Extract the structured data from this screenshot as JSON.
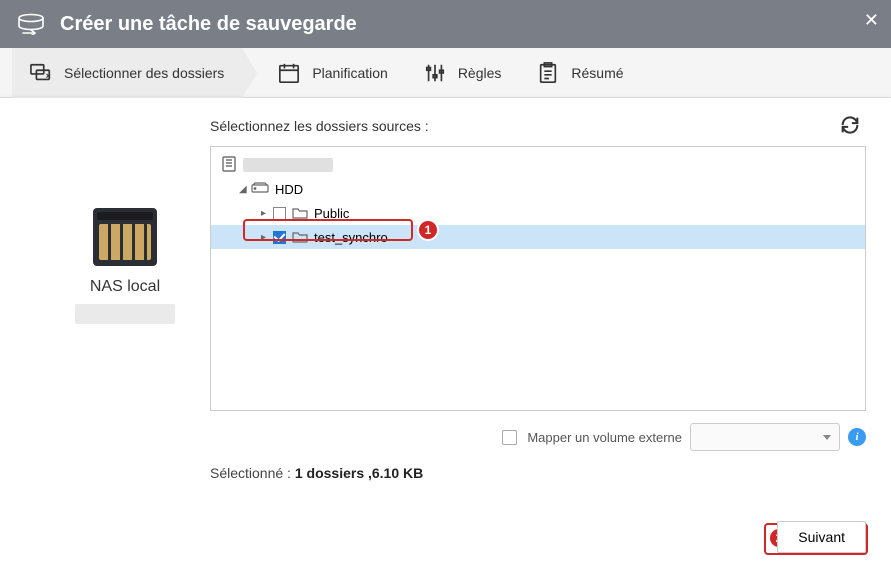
{
  "header": {
    "title": "Créer une tâche de sauvegarde"
  },
  "steps": {
    "select": "Sélectionner des dossiers",
    "schedule": "Planification",
    "rules": "Règles",
    "summary": "Résumé"
  },
  "left": {
    "label": "NAS local"
  },
  "panel": {
    "title": "Sélectionnez les dossiers sources :",
    "tree": {
      "hdd": "HDD",
      "public": "Public",
      "test_synchro": "test_synchro"
    }
  },
  "map": {
    "label": "Mapper un volume externe"
  },
  "status": {
    "prefix": "Sélectionné : ",
    "bold": "1 dossiers ,6.10 KB"
  },
  "buttons": {
    "next": "Suivant"
  },
  "callouts": {
    "one": "1",
    "two": "2"
  }
}
